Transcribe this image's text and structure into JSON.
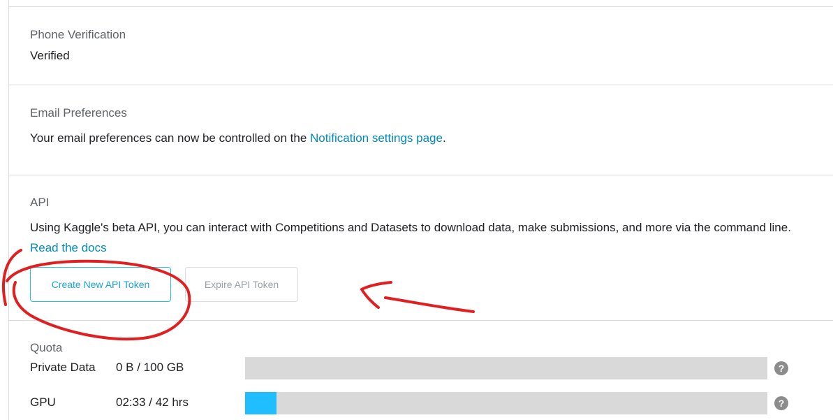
{
  "phone": {
    "title": "Phone Verification",
    "value": "Verified"
  },
  "email": {
    "title": "Email Preferences",
    "text_before": "Your email preferences can now be controlled on the ",
    "link": "Notification settings page",
    "text_after": "."
  },
  "api": {
    "title": "API",
    "description": "Using Kaggle's beta API, you can interact with Competitions and Datasets to download data, make submissions, and more via the command line. ",
    "docs_link": "Read the docs",
    "create_button": "Create New API Token",
    "expire_button": "Expire API Token"
  },
  "quota": {
    "title": "Quota",
    "rows": [
      {
        "label": "Private Data",
        "amount": "0 B / 100 GB",
        "fill_fraction": 0.0
      },
      {
        "label": "GPU",
        "amount": "02:33 / 42 hrs",
        "fill_fraction": 0.06
      }
    ],
    "help_glyph": "?"
  },
  "colors": {
    "accent": "#20beff",
    "link": "#008abc",
    "annotation": "#e02020"
  },
  "icons": {
    "help": "help-circle-icon"
  }
}
